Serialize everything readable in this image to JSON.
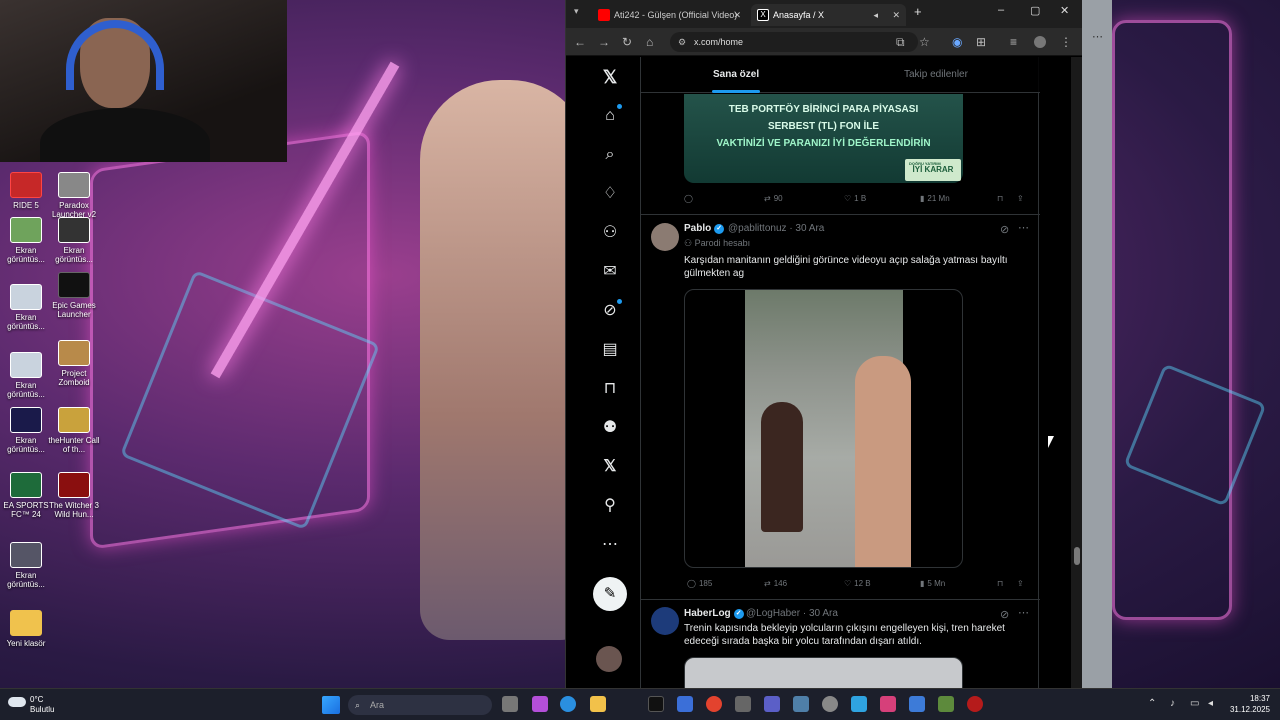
{
  "browser": {
    "tabs": [
      {
        "title": "Ati242 - Gülşen (Official Video)",
        "icon": "youtube-icon",
        "active": false
      },
      {
        "title": "Anasayfa / X",
        "icon": "x-icon",
        "active": true
      }
    ],
    "url": "x.com/home"
  },
  "feed": {
    "tabs": [
      "Sana özel",
      "Takip edilenler"
    ],
    "ad": {
      "line1": "TEB PORTFÖY BİRİNCİ PARA PİYASASI",
      "line2": "SERBEST (TL) FON İLE",
      "line3": "VAKTİNİZİ VE PARANIZI İYİ DEĞERLENDİRİN",
      "badge_top": "DOĞRU YATIRIM",
      "badge": "İYİ KARAR",
      "reposts": "90",
      "likes": "1 B",
      "views": "21 Mn"
    },
    "posts": [
      {
        "name": "Pablo",
        "handle": "@pablittonuz",
        "date": "· 30 Ara",
        "label": "Parodi hesabı",
        "text": "Karşıdan manitanın geldiğini görünce videoyu açıp salağa yatması bayıltı gülmekten ag",
        "replies": "185",
        "reposts": "146",
        "likes": "12 B",
        "views": "5 Mn"
      },
      {
        "name": "HaberLog",
        "handle": "@LogHaber",
        "date": "· 30 Ara",
        "text": "Trenin kapısında bekleyip yolcuların çıkışını engelleyen kişi, tren hareket edeceği sırada başka bir yolcu tarafından dışarı atıldı."
      }
    ]
  },
  "desktop": {
    "icons": [
      {
        "label": "RIDE 5"
      },
      {
        "label": "Paradox Launcher v2"
      },
      {
        "label": "Ekran görüntüs..."
      },
      {
        "label": "Ekran görüntüs..."
      },
      {
        "label": "Ekran görüntüs..."
      },
      {
        "label": "Epic Games Launcher"
      },
      {
        "label": "Ekran görüntüs..."
      },
      {
        "label": "Project Zomboid"
      },
      {
        "label": "Ekran görüntüs..."
      },
      {
        "label": "theHunter Call of th..."
      },
      {
        "label": "EA SPORTS FC™ 24"
      },
      {
        "label": "The Witcher 3 Wild Hun..."
      },
      {
        "label": "Ekran görüntüs..."
      },
      {
        "label": "Yeni klasör"
      }
    ]
  },
  "taskbar": {
    "weather_temp": "0°C",
    "weather_desc": "Bulutlu",
    "search_placeholder": "Ara",
    "time": "18:37",
    "date": "31.12.2025"
  }
}
